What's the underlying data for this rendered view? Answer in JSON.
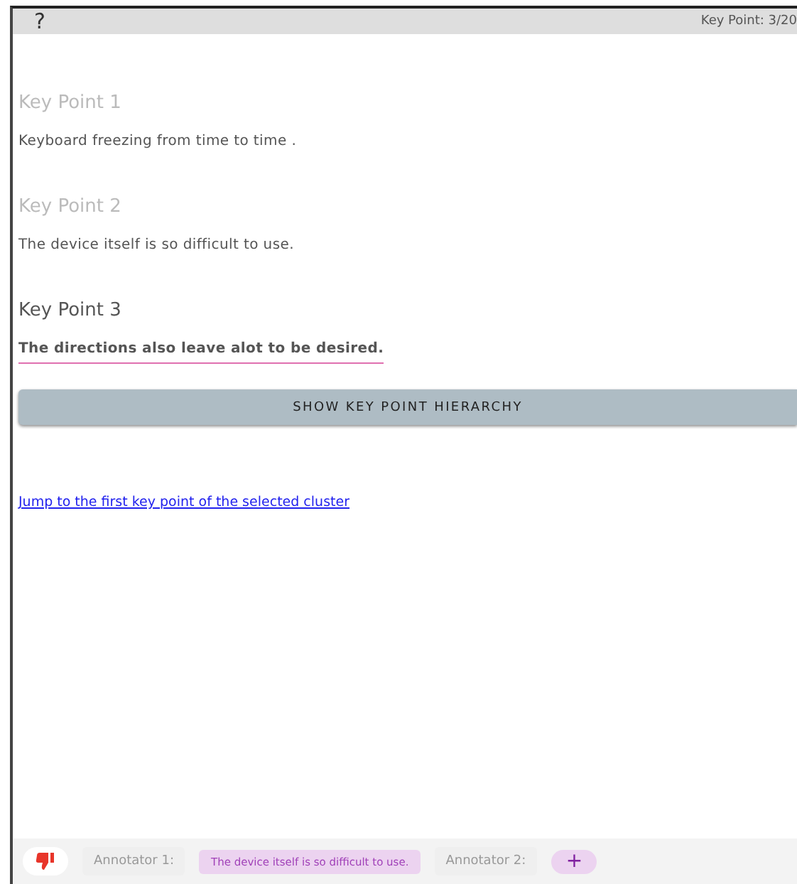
{
  "top_bar": {
    "help": "?",
    "counter": "Key Point: 3/20"
  },
  "key_points": [
    {
      "title": "Key Point 1",
      "text": "Keyboard freezing from time to time .",
      "selected": false
    },
    {
      "title": "Key Point 2",
      "text": "The device itself is so difficult to use.",
      "selected": false
    },
    {
      "title": "Key Point 3",
      "text": "The directions also leave alot to be desired.",
      "selected": true
    }
  ],
  "hierarchy_button": "SHOW KEY POINT HIERARCHY",
  "jump_link": "Jump to the first key point of the selected cluster",
  "bottom_bar": {
    "annotators": [
      {
        "label": "Annotator 1:",
        "kind": "answer",
        "value": "The device itself is so difficult to use."
      },
      {
        "label": "Annotator 2:",
        "kind": "add",
        "value": "+"
      }
    ]
  }
}
